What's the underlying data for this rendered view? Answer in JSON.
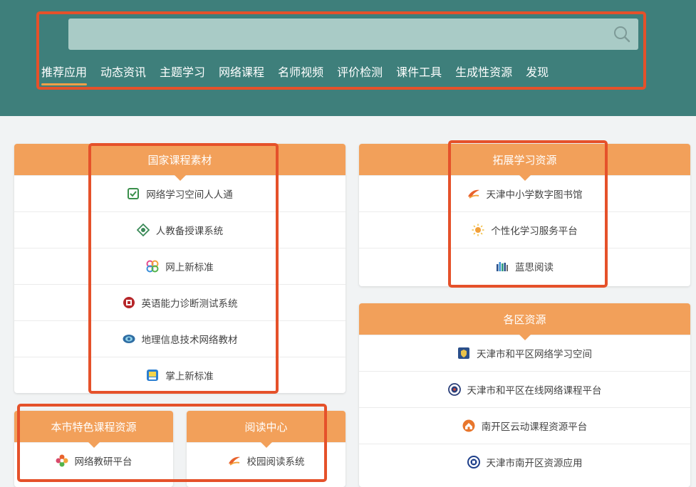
{
  "search": {
    "placeholder": ""
  },
  "nav": [
    {
      "label": "推荐应用",
      "active": true
    },
    {
      "label": "动态资讯"
    },
    {
      "label": "主题学习"
    },
    {
      "label": "网络课程"
    },
    {
      "label": "名师视频"
    },
    {
      "label": "评价检测"
    },
    {
      "label": "课件工具"
    },
    {
      "label": "生成性资源"
    },
    {
      "label": "发现"
    }
  ],
  "national": {
    "title": "国家课程素材",
    "items": [
      {
        "label": "网络学习空间人人通",
        "icon": "green-check-icon"
      },
      {
        "label": "人教备授课系统",
        "icon": "green-emblem-icon"
      },
      {
        "label": "网上新标准",
        "icon": "colorful-rings-icon"
      },
      {
        "label": "英语能力诊断测试系统",
        "icon": "red-badge-icon"
      },
      {
        "label": "地理信息技术网络教材",
        "icon": "globe-eye-icon"
      },
      {
        "label": "掌上新标准",
        "icon": "book-app-icon"
      }
    ]
  },
  "extended": {
    "title": "拓展学习资源",
    "items": [
      {
        "label": "天津中小学数字图书馆",
        "icon": "swoosh-logo-icon"
      },
      {
        "label": "个性化学习服务平台",
        "icon": "sun-icon"
      },
      {
        "label": "蓝思阅读",
        "icon": "bookshelf-icon"
      }
    ]
  },
  "district": {
    "title": "各区资源",
    "items": [
      {
        "label": "天津市和平区网络学习空间",
        "icon": "navy-shield-icon"
      },
      {
        "label": "天津市和平区在线网络课程平台",
        "icon": "round-seal-icon"
      },
      {
        "label": "南开区云动课程资源平台",
        "icon": "orange-house-icon"
      },
      {
        "label": "天津市南开区资源应用",
        "icon": "blue-seal-icon"
      }
    ]
  },
  "city": {
    "title": "本市特色课程资源",
    "items": [
      {
        "label": "网络教研平台",
        "icon": "flower-badge-icon"
      }
    ]
  },
  "reading": {
    "title": "阅读中心",
    "items": [
      {
        "label": "校园阅读系统",
        "icon": "swoosh-logo-icon"
      }
    ]
  }
}
